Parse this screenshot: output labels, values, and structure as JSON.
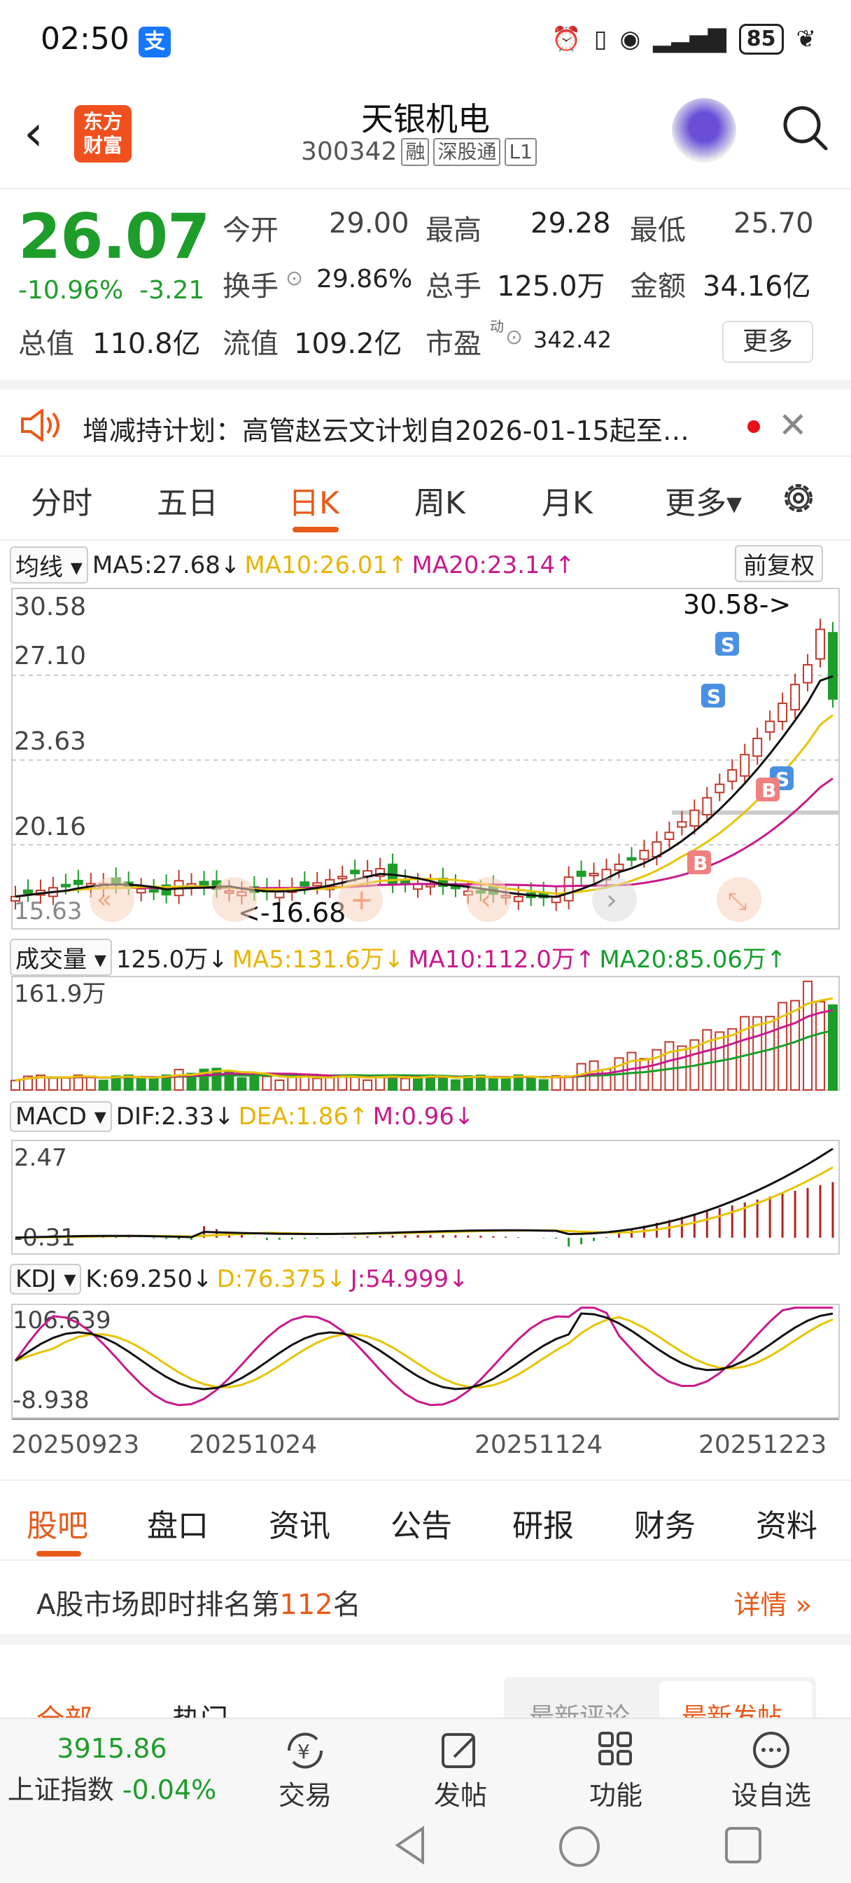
{
  "status": {
    "time": "02:50",
    "alipay": "支",
    "battery": "85"
  },
  "header": {
    "name": "天银机电",
    "code": "300342",
    "tags": [
      "融",
      "深股通",
      "L1"
    ],
    "logo": "东方\n财富"
  },
  "quote": {
    "price": "26.07",
    "pct": "-10.96%",
    "change": "-3.21",
    "open_label": "今开",
    "open": "29.00",
    "high_label": "最高",
    "high": "29.28",
    "low_label": "最低",
    "low": "25.70",
    "turnover_label": "换手",
    "turnover": "29.86%",
    "volume_label": "总手",
    "volume": "125.0万",
    "amount_label": "金额",
    "amount": "34.16亿",
    "mcap_label": "总值",
    "mcap": "110.8亿",
    "float_label": "流值",
    "float": "109.2亿",
    "pe_label": "市盈",
    "pe_sup": "动",
    "pe": "342.42",
    "more": "更多"
  },
  "notice": {
    "text": "增减持计划：高管赵云文计划自2026-01-15起至…"
  },
  "period_tabs": [
    "分时",
    "五日",
    "日K",
    "周K",
    "月K",
    "更多▾"
  ],
  "ma": {
    "sel": "均线",
    "ma5": "MA5:27.68↓",
    "ma10": "MA10:26.01↑",
    "ma20": "MA20:23.14↑",
    "fq": "前复权"
  },
  "kline_axis": {
    "y": [
      "30.58",
      "27.10",
      "23.63",
      "20.16"
    ],
    "y_low": "15.63",
    "max_label": "30.58->",
    "min_label": "<-16.68"
  },
  "vol": {
    "sel": "成交量",
    "cur": "125.0万↓",
    "ma5": "MA5:131.6万↓",
    "ma10": "MA10:112.0万↑",
    "ma20": "MA20:85.06万↑",
    "ymax": "161.9万"
  },
  "macd": {
    "sel": "MACD",
    "dif": "DIF:2.33↓",
    "dea": "DEA:1.86↑",
    "m": "M:0.96↓",
    "ymax": "2.47",
    "ymin": "-0.31"
  },
  "kdj": {
    "sel": "KDJ",
    "k": "K:69.250↓",
    "d": "D:76.375↓",
    "j": "J:54.999↓",
    "ymax": "106.639",
    "ymin": "-8.938"
  },
  "dates": [
    "20250923",
    "20251024",
    "20251124",
    "20251223"
  ],
  "bottom_tabs": [
    "股吧",
    "盘口",
    "资讯",
    "公告",
    "研报",
    "财务",
    "资料"
  ],
  "rank": {
    "prefix": "A股市场即时排名第",
    "num": "112",
    "suffix": "名",
    "detail": "详情"
  },
  "feed": {
    "left1": "全部",
    "left2": "热门",
    "right1": "最新评论",
    "right2": "最新发帖"
  },
  "nav": {
    "index_value": "3915.86",
    "index_name": "上证指数",
    "index_pct": "-0.04%",
    "items": [
      "交易",
      "发帖",
      "功能",
      "设自选"
    ]
  },
  "colors": {
    "up": "#e8392c",
    "down": "#1e9d2a",
    "accent": "#e85a1a"
  }
}
